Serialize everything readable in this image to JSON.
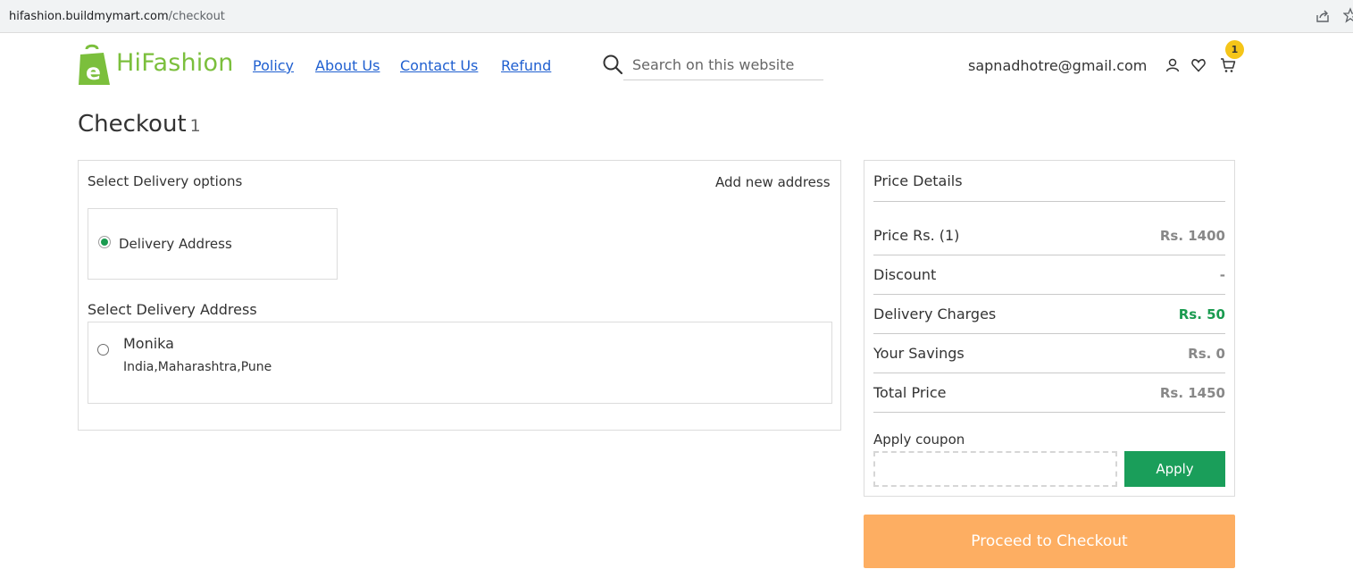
{
  "browser": {
    "url_host": "hifashion.buildmymart.com",
    "url_path": "/checkout"
  },
  "header": {
    "logo_text": "HiFashion",
    "nav": [
      "Policy",
      "About Us",
      "Contact Us",
      "Refund"
    ],
    "search_placeholder": "Search on this website",
    "user_email": "sapnadhotre@gmail.com",
    "cart_count": "1"
  },
  "page": {
    "title": "Checkout",
    "item_count": "1"
  },
  "delivery": {
    "heading": "Select Delivery options",
    "add_new_address": "Add new address",
    "option_label": "Delivery Address",
    "option_selected": true,
    "address_heading": "Select Delivery Address",
    "addresses": [
      {
        "name": "Monika",
        "line": "India,Maharashtra,Pune",
        "selected": false
      }
    ]
  },
  "price_details": {
    "title": "Price Details",
    "rows": [
      {
        "label": "Price Rs. (1)",
        "value": "Rs. 1400"
      },
      {
        "label": "Discount",
        "value": "-"
      },
      {
        "label": "Delivery Charges",
        "value": "Rs. 50",
        "highlight": true
      },
      {
        "label": "Your Savings",
        "value": "Rs. 0"
      },
      {
        "label": "Total Price",
        "value": "Rs. 1450"
      }
    ],
    "coupon_label": "Apply coupon",
    "coupon_value": "",
    "apply_label": "Apply"
  },
  "checkout": {
    "button_label": "Proceed to Checkout"
  },
  "colors": {
    "brand_green": "#7bbf3c",
    "link_blue": "#1f5fd0",
    "apply_green": "#1a9e5a",
    "checkout_orange": "#fdae62",
    "badge_yellow": "#f5c518"
  },
  "icons": [
    "share-icon",
    "bookmark-star-icon",
    "shopping-bag-logo-icon",
    "search-icon",
    "user-icon",
    "heart-icon",
    "cart-icon"
  ]
}
